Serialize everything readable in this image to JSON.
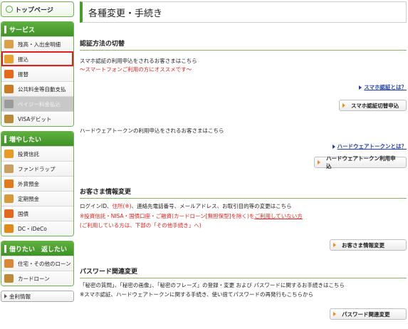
{
  "sidebar": {
    "top_label": "トップページ",
    "sections": [
      {
        "title": "サービス",
        "items": [
          {
            "label": "残高・入出金明細",
            "icon": "coin-bag-icon",
            "color": "#d9a14a"
          },
          {
            "label": "振込",
            "icon": "transfer-icon",
            "color": "#e8a12c",
            "selected": true
          },
          {
            "label": "振替",
            "icon": "exchange-icon",
            "color": "#e36a1c"
          },
          {
            "label": "公共料金等自動支払",
            "icon": "faucet-icon",
            "color": "#cc7b24"
          },
          {
            "label": "ペイジー料金払込",
            "icon": "pay-easy-icon",
            "color": "#9b9b9b",
            "disabled": true
          },
          {
            "label": "VISAデビット",
            "icon": "card-icon",
            "color": "#b98a3a"
          }
        ]
      },
      {
        "title": "増やしたい",
        "items": [
          {
            "label": "投資信託",
            "icon": "bar-chart-icon",
            "color": "#e59a2a"
          },
          {
            "label": "ファンドラップ",
            "icon": "document-icon",
            "color": "#c9a060"
          },
          {
            "label": "外貨預金",
            "icon": "dollar-icon",
            "color": "#e07b1c"
          },
          {
            "label": "定期預金",
            "icon": "medal-icon",
            "color": "#d59a3a"
          },
          {
            "label": "国債",
            "icon": "bond-icon",
            "color": "#e3671c"
          },
          {
            "label": "DC・iDeCo",
            "icon": "pie-chart-icon",
            "color": "#e08a1c"
          }
        ]
      },
      {
        "title": "借りたい　返したい",
        "items": [
          {
            "label": "住宅・その他のローン",
            "icon": "house-icon",
            "color": "#d9883a"
          },
          {
            "label": "カードローン",
            "icon": "loan-card-icon",
            "color": "#c08a3a"
          }
        ]
      }
    ],
    "rates_label": "金利情報"
  },
  "main": {
    "page_title": "各種変更・手続き",
    "auth": {
      "heading": "認証方法の切替",
      "line1": "スマホ認証の利用申込をされるお客さまはこちら",
      "line2": "～スマートフォンご利用の方にオススメです～",
      "link1": "スマホ認証とは？",
      "button1": "スマホ認証切替申込",
      "line3": "ハードウェアトークンの利用申込をされるお客さまはこちら",
      "link2": "ハードウェアトークンとは？",
      "button2": "ハードウェアトークン利用申込"
    },
    "customer": {
      "heading": "お客さま情報変更",
      "line1_a": "ログインID、",
      "line1_b": "住所(※)",
      "line1_c": "、連絡先電話番号、メールアドレス、お取引目的等の変更はこちら",
      "line2_a": "※投資信託・NISA・国債口座・ご融資(カードローン[無担保型]を除く)を",
      "line2_b": "ご利用していない方",
      "line3": "(ご利用している方は、下部の「その他手続き」へ)",
      "button": "お客さま情報変更"
    },
    "password": {
      "heading": "パスワード関連変更",
      "line1": "「秘密の質問」、「秘密の画像」、「秘密のフレーズ」の登録・変更 および パスワードに関するお手続きはこちら",
      "line2": "※スマホ認証、ハードウェアトークンに関する手続き、使い捨てパスワードの再発行もこちらから",
      "button": "パスワード関連変更"
    }
  }
}
